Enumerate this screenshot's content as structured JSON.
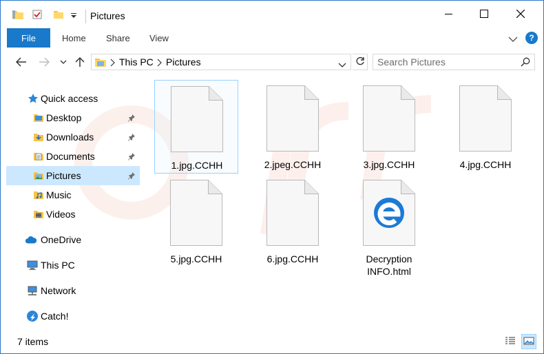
{
  "window": {
    "title": "Pictures",
    "controls": {
      "minimize": "minimize-icon",
      "maximize": "maximize-icon",
      "close": "close-icon"
    }
  },
  "ribbon": {
    "file_tab": "File",
    "tabs": [
      "Home",
      "Share",
      "View"
    ],
    "help": "?"
  },
  "address": {
    "segments": [
      "This PC",
      "Pictures"
    ],
    "search_placeholder": "Search Pictures"
  },
  "sidebar": {
    "items": [
      {
        "label": "Quick access",
        "icon": "star-icon"
      },
      {
        "label": "Desktop",
        "icon": "desktop-folder-icon",
        "pinned": true
      },
      {
        "label": "Downloads",
        "icon": "downloads-folder-icon",
        "pinned": true
      },
      {
        "label": "Documents",
        "icon": "documents-folder-icon",
        "pinned": true
      },
      {
        "label": "Pictures",
        "icon": "pictures-folder-icon",
        "pinned": true,
        "selected": true
      },
      {
        "label": "Music",
        "icon": "music-folder-icon"
      },
      {
        "label": "Videos",
        "icon": "videos-folder-icon"
      },
      {
        "label": "OneDrive",
        "icon": "onedrive-cloud-icon"
      },
      {
        "label": "This PC",
        "icon": "this-pc-icon"
      },
      {
        "label": "Network",
        "icon": "network-icon"
      },
      {
        "label": "Catch!",
        "icon": "catch-icon"
      }
    ]
  },
  "files": [
    {
      "name": "1.jpg.CCHH",
      "icon": "blank-file-icon",
      "selected": true
    },
    {
      "name": "2.jpeg.CCHH",
      "icon": "blank-file-icon"
    },
    {
      "name": "3.jpg.CCHH",
      "icon": "blank-file-icon"
    },
    {
      "name": "4.jpg.CCHH",
      "icon": "blank-file-icon"
    },
    {
      "name": "5.jpg.CCHH",
      "icon": "blank-file-icon"
    },
    {
      "name": "6.jpg.CCHH",
      "icon": "blank-file-icon"
    },
    {
      "name_line1": "Decryption",
      "name_line2": "INFO.html",
      "icon": "edge-html-file-icon"
    }
  ],
  "status": {
    "item_count": "7 items"
  },
  "colors": {
    "accent": "#1979ca",
    "selection": "#cce8ff",
    "selection_border": "#99d1ff"
  }
}
